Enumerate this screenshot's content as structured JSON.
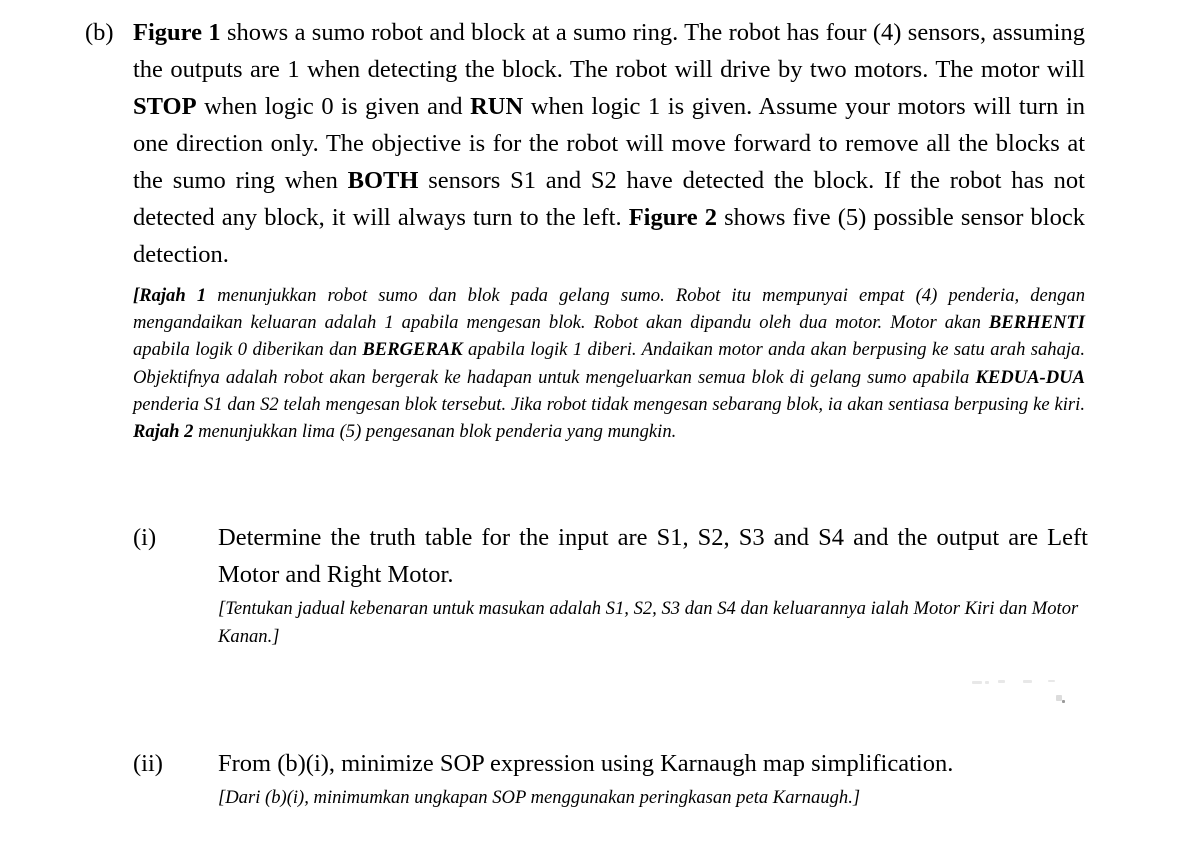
{
  "document": {
    "type": "exam-question",
    "background_color": "#ffffff",
    "text_color": "#000000"
  },
  "part_b": {
    "label": "(b)",
    "english": {
      "segments": [
        {
          "text": "Figure 1",
          "bold": true
        },
        {
          "text": " shows a sumo robot and block at a sumo ring. The robot has four (4) sensors, assuming the outputs are 1 when detecting the block. The robot will drive by two motors. The motor will ",
          "bold": false
        },
        {
          "text": "STOP",
          "bold": true
        },
        {
          "text": " when logic 0 is given and ",
          "bold": false
        },
        {
          "text": "RUN",
          "bold": true
        },
        {
          "text": " when logic 1 is given. Assume your motors will turn in one direction only. The objective is for the robot will move forward to remove all the blocks at the sumo ring when ",
          "bold": false
        },
        {
          "text": "BOTH",
          "bold": true
        },
        {
          "text": " sensors S1 and S2 have detected the block. If the robot has not detected any block, it will always turn to the left. ",
          "bold": false
        },
        {
          "text": "Figure 2",
          "bold": true
        },
        {
          "text": " shows five (5) possible sensor block detection.",
          "bold": false
        }
      ],
      "plain": "Figure 1 shows a sumo robot and block at a sumo ring. The robot has four (4) sensors, assuming the outputs are 1 when detecting the block. The robot will drive by two motors. The motor will STOP when logic 0 is given and RUN when logic 1 is given. Assume your motors will turn in one direction only. The objective is for the robot will move forward to remove all the blocks at the sumo ring when BOTH sensors S1 and S2 have detected the block. If the robot has not detected any block, it will always turn to the left. Figure 2 shows five (5) possible sensor block detection."
    },
    "malay": {
      "segments": [
        {
          "text": "[Rajah 1",
          "bold": true
        },
        {
          "text": " menunjukkan robot sumo dan blok pada gelang sumo. Robot itu mempunyai empat (4) penderia, dengan mengandaikan keluaran adalah 1 apabila mengesan blok. Robot akan dipandu oleh dua motor. Motor akan ",
          "bold": false
        },
        {
          "text": "BERHENTI",
          "bold": true
        },
        {
          "text": " apabila logik 0 diberikan dan ",
          "bold": false
        },
        {
          "text": "BERGERAK",
          "bold": true
        },
        {
          "text": " apabila logik 1 diberi. Andaikan motor anda akan berpusing ke satu arah sahaja. Objektifnya adalah robot akan bergerak ke hadapan untuk mengeluarkan semua blok di gelang sumo apabila ",
          "bold": false
        },
        {
          "text": "KEDUA-DUA",
          "bold": true
        },
        {
          "text": " penderia S1 dan S2 telah mengesan blok tersebut. Jika robot tidak mengesan sebarang blok, ia akan sentiasa berpusing ke kiri. ",
          "bold": false
        },
        {
          "text": "Rajah 2",
          "bold": true
        },
        {
          "text": " menunjukkan lima (5) pengesanan blok penderia yang mungkin.",
          "bold": false
        }
      ],
      "plain": "[Rajah 1 menunjukkan robot sumo dan blok pada gelang sumo. Robot itu mempunyai empat (4) penderia, dengan mengandaikan keluaran adalah 1 apabila mengesan blok. Robot akan dipandu oleh dua motor. Motor akan BERHENTI apabila logik 0 diberikan dan BERGERAK apabila logik 1 diberi. Andaikan motor anda akan berpusing ke satu arah sahaja. Objektifnya adalah robot akan bergerak ke hadapan untuk mengeluarkan semua blok di gelang sumo apabila KEDUA-DUA penderia S1 dan S2 telah mengesan blok tersebut. Jika robot tidak mengesan sebarang blok, ia akan sentiasa berpusing ke kiri. Rajah 2 menunjukkan lima (5) pengesanan blok penderia yang mungkin."
    }
  },
  "subitems": [
    {
      "label": "(i)",
      "english": "Determine the truth table for the input are S1, S2, S3 and S4 and the output are Left Motor and Right Motor.",
      "malay": "[Tentukan jadual kebenaran untuk masukan adalah S1, S2, S3 dan S4 dan keluarannya ialah Motor Kiri dan Motor Kanan.]"
    },
    {
      "label": "(ii)",
      "english": "From (b)(i), minimize SOP expression using Karnaugh map simplification.",
      "malay": "[Dari (b)(i), minimumkan ungkapan SOP menggunakan peringkasan peta Karnaugh.]"
    }
  ]
}
